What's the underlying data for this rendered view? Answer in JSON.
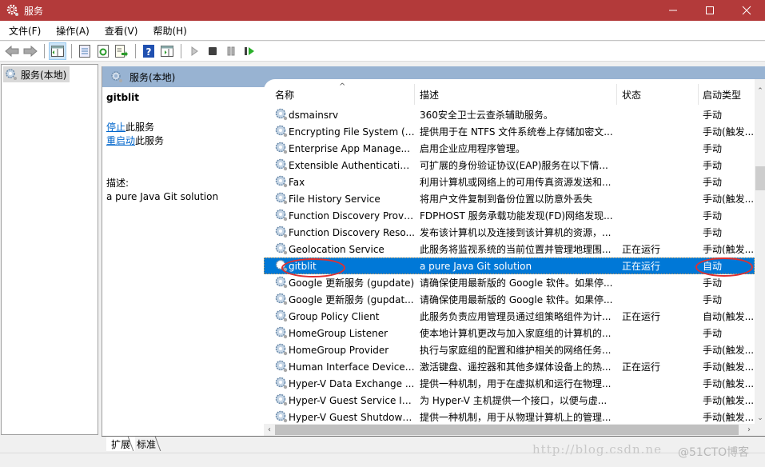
{
  "window": {
    "title": "服务",
    "controls": [
      "minimize",
      "maximize",
      "close"
    ]
  },
  "menu": [
    {
      "label": "文件(F)"
    },
    {
      "label": "操作(A)"
    },
    {
      "label": "查看(V)"
    },
    {
      "label": "帮助(H)"
    }
  ],
  "toolbar": {
    "buttons": [
      "back-arrow-icon",
      "forward-arrow-icon",
      "show-hide-tree-icon",
      "properties-icon",
      "refresh-icon",
      "export-list-icon",
      "help-icon",
      "show-action-pane-icon",
      "start-service-icon",
      "stop-service-icon",
      "pause-service-icon",
      "restart-service-icon"
    ]
  },
  "tree": {
    "root_label": "服务(本地)"
  },
  "content": {
    "header_title": "服务(本地)",
    "detail": {
      "service_name": "gitblit",
      "stop_link": "停止",
      "stop_suffix": "此服务",
      "restart_link": "重启动",
      "restart_suffix": "此服务",
      "desc_label": "描述:",
      "desc_text": "a pure Java Git solution"
    },
    "columns": {
      "name": "名称",
      "desc": "描述",
      "status": "状态",
      "startup": "启动类型",
      "sort_indicator": "^"
    },
    "rows": [
      {
        "name": "dsmainsrv",
        "desc": "360安全卫士云查杀辅助服务。",
        "status": "",
        "startup": "手动"
      },
      {
        "name": "Encrypting File System (E...",
        "desc": "提供用于在 NTFS 文件系统卷上存储加密文...",
        "status": "",
        "startup": "手动(触发..."
      },
      {
        "name": "Enterprise App Manage...",
        "desc": "启用企业应用程序管理。",
        "status": "",
        "startup": "手动"
      },
      {
        "name": "Extensible Authentication...",
        "desc": "可扩展的身份验证协议(EAP)服务在以下情...",
        "status": "",
        "startup": "手动"
      },
      {
        "name": "Fax",
        "desc": "利用计算机或网络上的可用传真资源发送和...",
        "status": "",
        "startup": "手动"
      },
      {
        "name": "File History Service",
        "desc": "将用户文件复制到备份位置以防意外丢失",
        "status": "",
        "startup": "手动(触发..."
      },
      {
        "name": "Function Discovery Provi...",
        "desc": "FDPHOST 服务承载功能发现(FD)网络发现...",
        "status": "",
        "startup": "手动"
      },
      {
        "name": "Function Discovery Reso...",
        "desc": "发布该计算机以及连接到该计算机的资源，...",
        "status": "",
        "startup": "手动"
      },
      {
        "name": "Geolocation Service",
        "desc": "此服务将监视系统的当前位置并管理地理围...",
        "status": "正在运行",
        "startup": "手动(触发..."
      },
      {
        "name": "gitblit",
        "desc": "a pure Java Git solution",
        "status": "正在运行",
        "startup": "自动",
        "selected": true
      },
      {
        "name": "Google 更新服务 (gupdate)",
        "desc": "请确保使用最新版的 Google 软件。如果停...",
        "status": "",
        "startup": "手动"
      },
      {
        "name": "Google 更新服务 (gupdat...",
        "desc": "请确保使用最新版的 Google 软件。如果停...",
        "status": "",
        "startup": "手动"
      },
      {
        "name": "Group Policy Client",
        "desc": "此服务负责应用管理员通过组策略组件为计...",
        "status": "正在运行",
        "startup": "自动(触发..."
      },
      {
        "name": "HomeGroup Listener",
        "desc": "使本地计算机更改与加入家庭组的计算机的...",
        "status": "",
        "startup": "手动"
      },
      {
        "name": "HomeGroup Provider",
        "desc": "执行与家庭组的配置和维护相关的网络任务...",
        "status": "",
        "startup": "手动(触发..."
      },
      {
        "name": "Human Interface Device ...",
        "desc": "激活键盘、遥控器和其他多媒体设备上的热...",
        "status": "正在运行",
        "startup": "手动(触发..."
      },
      {
        "name": "Hyper-V Data Exchange ...",
        "desc": "提供一种机制，用于在虚拟机和运行在物理...",
        "status": "",
        "startup": "手动(触发..."
      },
      {
        "name": "Hyper-V Guest Service In...",
        "desc": "为 Hyper-V 主机提供一个接口，以便与虚...",
        "status": "",
        "startup": "手动(触发..."
      },
      {
        "name": "Hyper-V Guest Shutdown...",
        "desc": "提供一种机制，用于从物理计算机上的管理...",
        "status": "",
        "startup": "手动(触发..."
      }
    ]
  },
  "tabs": [
    {
      "label": "扩展",
      "active": true
    },
    {
      "label": "标准",
      "active": false
    }
  ],
  "watermark": {
    "url": "http://blog.csdn.ne",
    "brand": "@51CTO博客"
  },
  "colors": {
    "titlebar": "#b33a3a",
    "selection": "#0078d7",
    "header_band": "#98b3d2",
    "link": "#0066cc",
    "annotation": "#e03030"
  }
}
